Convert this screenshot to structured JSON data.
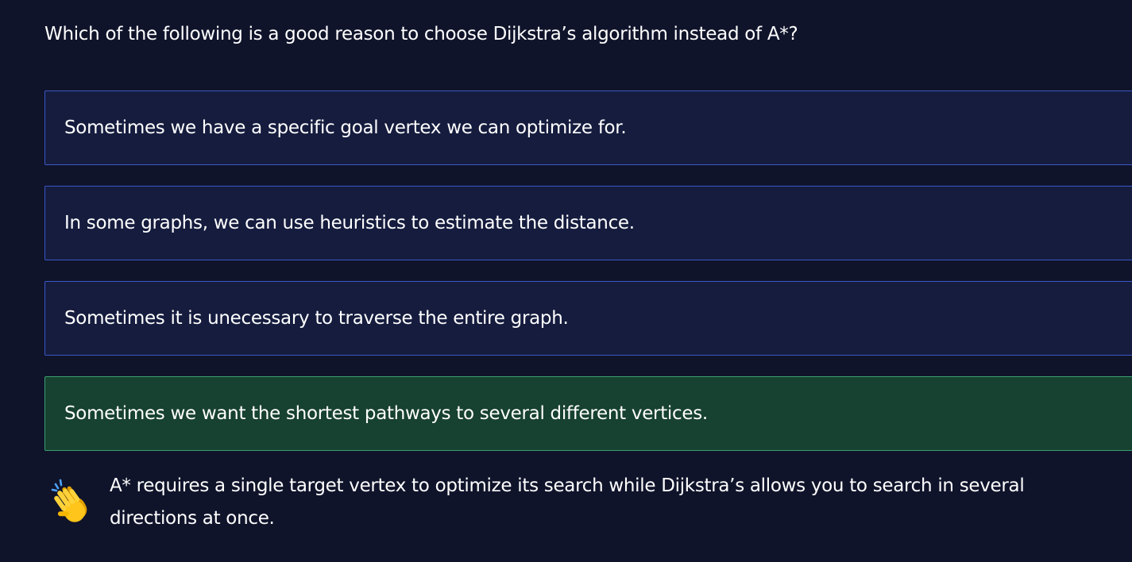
{
  "question": {
    "text": "Which of the following is a good reason to choose Dijkstra’s algorithm instead of A*?"
  },
  "options": [
    {
      "label": "Sometimes we have a specific goal vertex we can optimize for.",
      "state": "default"
    },
    {
      "label": "In some graphs, we can use heuristics to estimate the distance.",
      "state": "default"
    },
    {
      "label": "Sometimes it is unecessary to traverse the entire graph.",
      "state": "default"
    },
    {
      "label": "Sometimes we want the shortest pathways to several different vertices.",
      "state": "correct"
    }
  ],
  "feedback": {
    "icon": "clapping-hands-icon",
    "text": "A* requires a single target vertex to optimize its search while Dijkstra’s allows you to search in several directions at once."
  },
  "colors": {
    "background": "#10142b",
    "option_background": "#151c3e",
    "option_border": "#3958c5",
    "correct_background": "#174130",
    "correct_border": "#3a9f6f"
  }
}
